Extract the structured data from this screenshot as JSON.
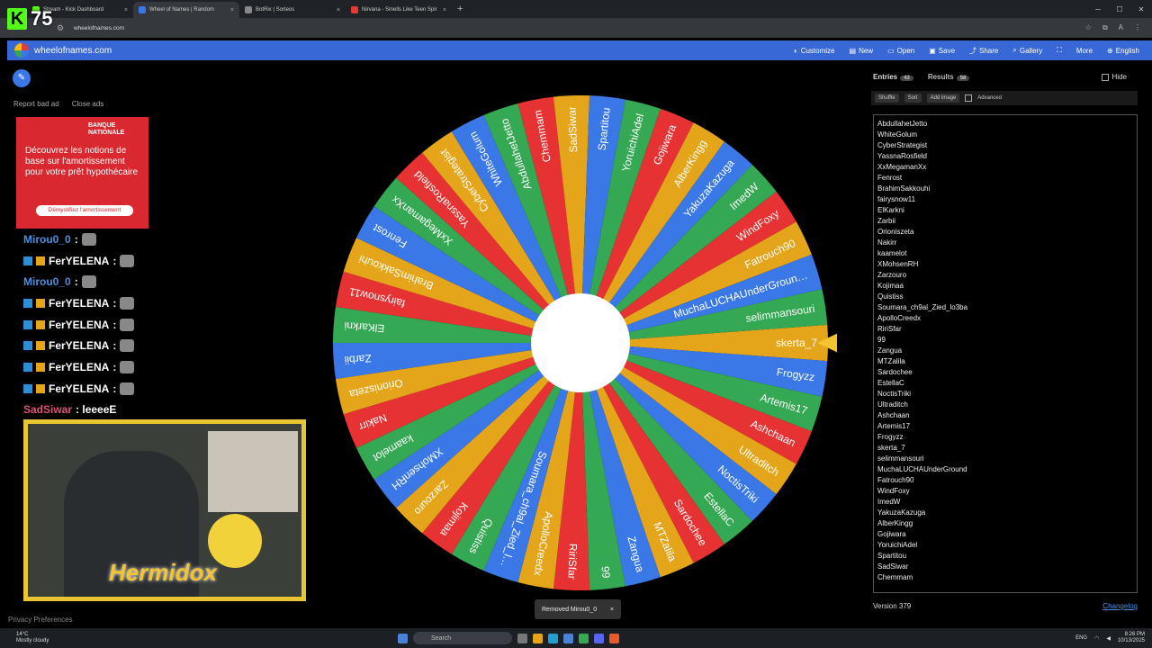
{
  "browser": {
    "tabs": [
      {
        "title": "Stream - Kick Dashboard",
        "color": "#53fc18"
      },
      {
        "title": "Wheel of Names | Random",
        "color": "#3b78e7"
      },
      {
        "title": "BotRix | Sorteos",
        "color": "#888888"
      },
      {
        "title": "Nirvana - Smells Like Teen Spir",
        "color": "#e53935"
      }
    ],
    "url": "wheelofnames.com",
    "profile": "A"
  },
  "kick": {
    "count": "75"
  },
  "site": {
    "name": "wheelofnames.com",
    "nav": [
      "Customize",
      "New",
      "Open",
      "Save",
      "Share",
      "Gallery",
      "More",
      "English"
    ]
  },
  "left": {
    "report": "Report bad ad",
    "close": "Close ads",
    "ad": {
      "brand_line1": "BANQUE",
      "brand_line2": "NATIONALE",
      "text": "Découvrez les notions de base sur l'amortissement pour votre prêt hypothécaire",
      "cta": "Démystifiez l'amortissement"
    },
    "privacy": "Privacy Preferences"
  },
  "chat": [
    {
      "user": "Mirou0_0",
      "msg": ":",
      "color": "#4a90e2",
      "badges": false
    },
    {
      "user": "FerYELENA",
      "msg": ":",
      "color": "#ffffff",
      "badges": true
    },
    {
      "user": "Mirou0_0",
      "msg": ":",
      "color": "#4a90e2",
      "badges": false
    },
    {
      "user": "FerYELENA",
      "msg": ":",
      "color": "#ffffff",
      "badges": true
    },
    {
      "user": "FerYELENA",
      "msg": ":",
      "color": "#ffffff",
      "badges": true
    },
    {
      "user": "FerYELENA",
      "msg": ":",
      "color": "#ffffff",
      "badges": true
    },
    {
      "user": "FerYELENA",
      "msg": ":",
      "color": "#ffffff",
      "badges": true
    },
    {
      "user": "FerYELENA",
      "msg": ":",
      "color": "#ffffff",
      "badges": true
    },
    {
      "user": "SadSiwar",
      "msg": ": leeeeE",
      "color": "#e0527a",
      "badges": false
    }
  ],
  "cam": {
    "caption": "Hermidox"
  },
  "wheel": {
    "colors": [
      "#e5a51b",
      "#3b78e7",
      "#34a853",
      "#e63232"
    ],
    "pointer_color": "#f4c430",
    "segments": [
      "skerta_7",
      "Frogyzz",
      "Artemis17",
      "Ashchaan",
      "Ultraditch",
      "NoctisTriki",
      "EstellaC",
      "Sardochee",
      "MTZalila",
      "Zangua",
      "99",
      "RiriSfar",
      "ApolloCreedx",
      "Soumara_ch9al_Zied_lo3ba",
      "Quistiss",
      "Kojimaa",
      "Zarzouro",
      "XMohsenRH",
      "kaamelot",
      "Nakirr",
      "Orioniszeta",
      "Zarbii",
      "ElKarkni",
      "fairysnow11",
      "BrahimSakkouhi",
      "Fenrost",
      "XxMegamanXx",
      "YassnaRosfield",
      "CyberStrategist",
      "WhiteGolum",
      "AbdullahetJetto",
      "Chemmam",
      "SadSiwar",
      "Spartitou",
      "YoruichiAdel",
      "Gojiwara",
      "AlberKingg",
      "YakuzaKazuga",
      "ImedW",
      "WindFoxy",
      "Fatrouch90",
      "MuchaLUCHAUnderGround",
      "selimmansouri"
    ]
  },
  "sidebar": {
    "tab_entries": "Entries",
    "entries_count": "43",
    "tab_results": "Results",
    "results_count": "58",
    "hide": "Hide",
    "toolbar": [
      "Shuffle",
      "Sort",
      "Add image",
      "Advanced"
    ],
    "entries": [
      "AbdullahetJetto",
      "WhiteGolum",
      "CyberStrategist",
      "YassnaRosfield",
      "XxMegamanXx",
      "Fenrost",
      "BrahimSakkouhi",
      "fairysnow11",
      "ElKarkni",
      "Zarbii",
      "Orioniszeta",
      "Nakirr",
      "kaamelot",
      "XMohsenRH",
      "Zarzouro",
      "Kojimaa",
      "Quistiss",
      "Soumara_ch9al_Zied_lo3ba",
      "ApolloCreedx",
      "RiriSfar",
      "99",
      "Zangua",
      "MTZalila",
      "Sardochee",
      "EstellaC",
      "NoctisTriki",
      "Ultraditch",
      "Ashchaan",
      "Artemis17",
      "Frogyzz",
      "skerta_7",
      "selimmansouri",
      "MuchaLUCHAUnderGround",
      "Fatrouch90",
      "WindFoxy",
      "ImedW",
      "YakuzaKazuga",
      "AlberKingg",
      "Gojiwara",
      "YoruichiAdel",
      "Spartitou",
      "SadSiwar",
      "Chemmam"
    ],
    "version": "Version 379",
    "changelog": "Changelog"
  },
  "toast": {
    "text": "Removed Mirou0_0",
    "close": "×"
  },
  "taskbar": {
    "temp": "14°C",
    "weather": "Mostly cloudy",
    "search": "Search",
    "lang": "ENG",
    "time": "8:26 PM",
    "date": "10/13/2025"
  }
}
